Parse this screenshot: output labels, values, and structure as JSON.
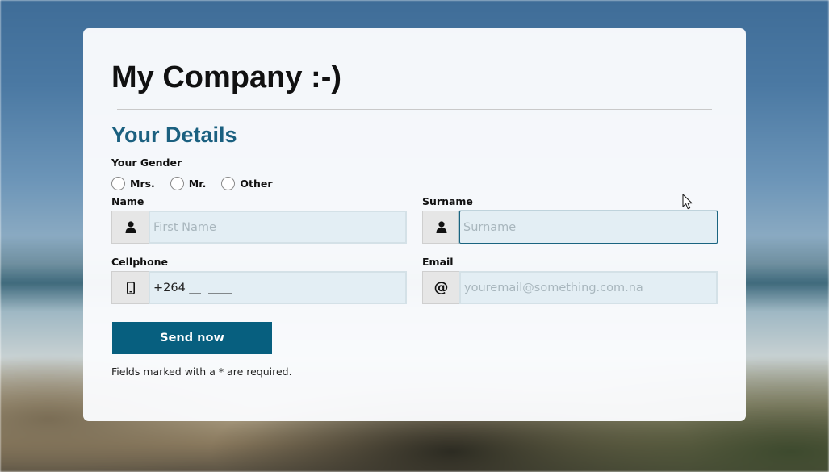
{
  "page": {
    "title": "My Company :-)",
    "section_title": "Your Details"
  },
  "gender": {
    "label": "Your Gender",
    "options": [
      "Mrs.",
      "Mr.",
      "Other"
    ]
  },
  "fields": {
    "name": {
      "label": "Name",
      "placeholder": "First Name",
      "value": "",
      "icon": "user-icon"
    },
    "surname": {
      "label": "Surname",
      "placeholder": "Surname",
      "value": "",
      "icon": "user-icon"
    },
    "cellphone": {
      "label": "Cellphone",
      "placeholder": "",
      "value": "+264 __  ____",
      "icon": "mobile-phone-icon"
    },
    "email": {
      "label": "Email",
      "placeholder": "youremail@something.com.na",
      "value": "",
      "icon": "at-sign-icon",
      "icon_glyph": "@"
    }
  },
  "form": {
    "submit_label": "Send now",
    "required_note": "Fields marked with a * are required."
  },
  "colors": {
    "accent": "#075f7f",
    "heading": "#1b6080",
    "input_bg": "#e3eef4"
  }
}
